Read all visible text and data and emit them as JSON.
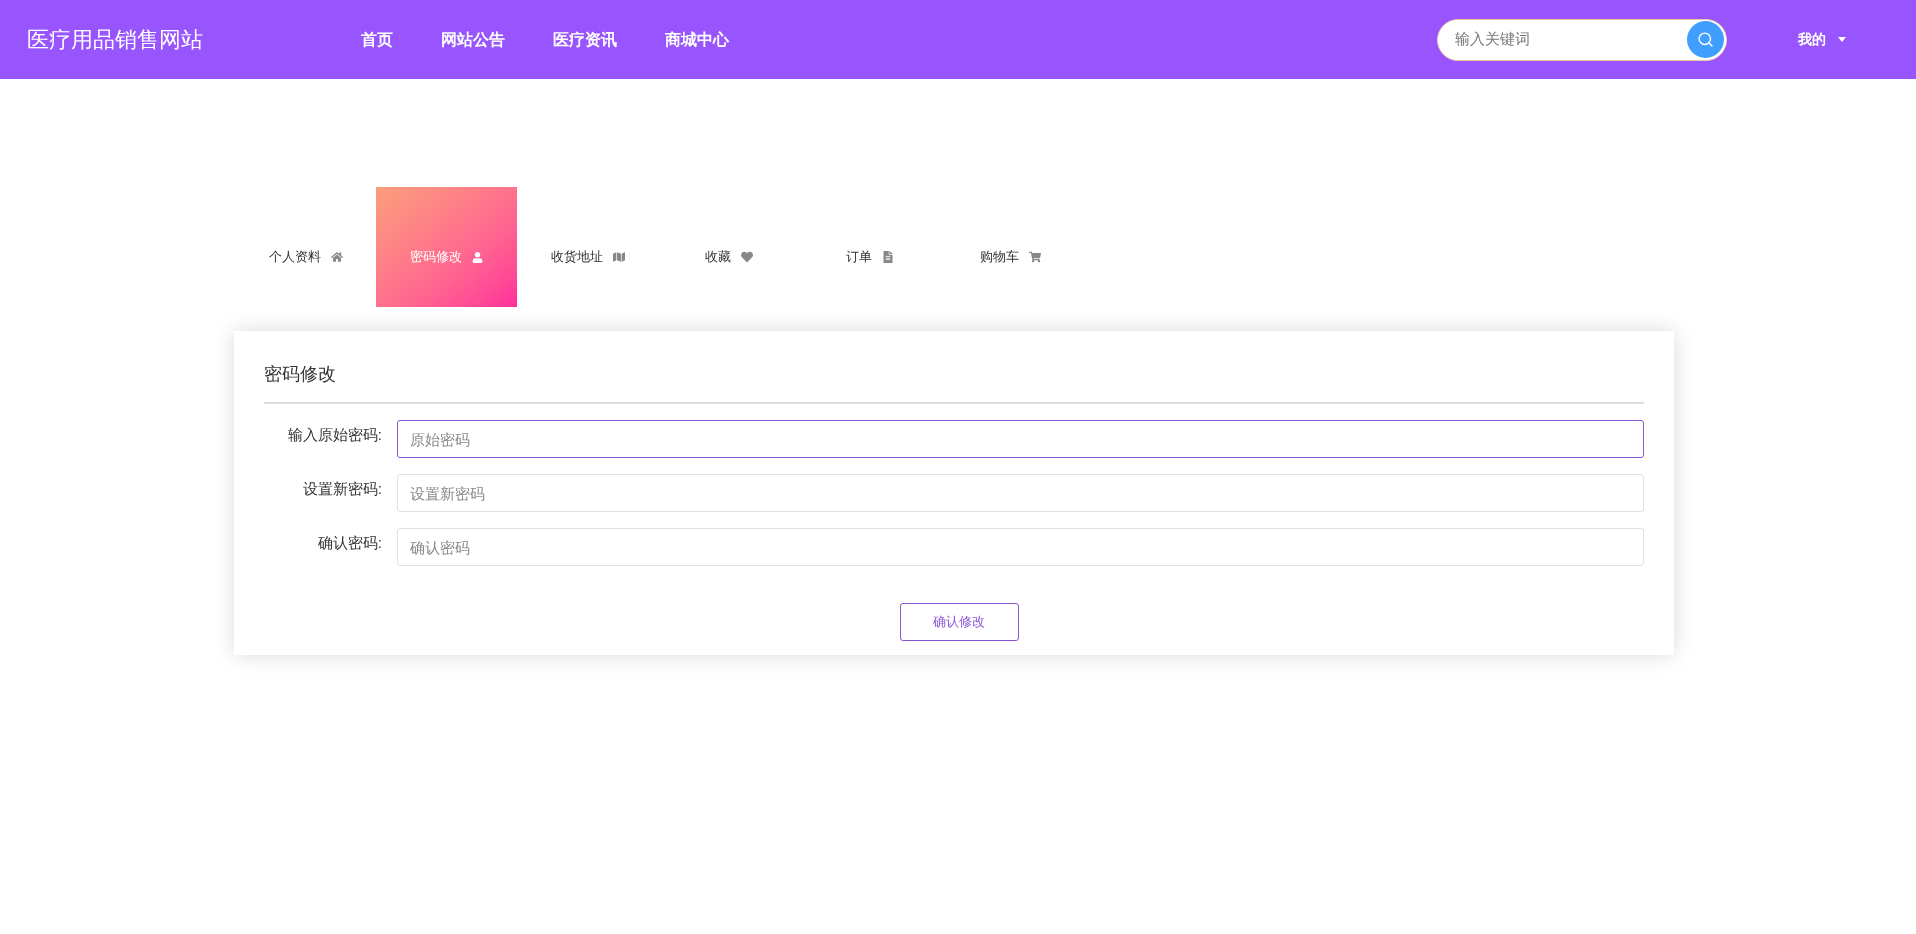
{
  "header": {
    "site_title": "医疗用品销售网站",
    "nav": [
      {
        "label": "首页"
      },
      {
        "label": "网站公告"
      },
      {
        "label": "医疗资讯"
      },
      {
        "label": "商城中心"
      }
    ],
    "search": {
      "placeholder": "输入关键词"
    },
    "user_menu": {
      "label": "我的"
    }
  },
  "tabs": [
    {
      "label": "个人资料",
      "selected": false
    },
    {
      "label": "密码修改",
      "selected": true
    },
    {
      "label": "收货地址",
      "selected": false
    },
    {
      "label": "收藏",
      "selected": false
    },
    {
      "label": "订单",
      "selected": false
    },
    {
      "label": "购物车",
      "selected": false
    }
  ],
  "form": {
    "title": "密码修改",
    "fields": [
      {
        "label": "输入原始密码:",
        "placeholder": "原始密码",
        "focused": true
      },
      {
        "label": "设置新密码:",
        "placeholder": "设置新密码",
        "focused": false
      },
      {
        "label": "确认密码:",
        "placeholder": "确认密码",
        "focused": false
      }
    ],
    "submit": "确认修改"
  }
}
